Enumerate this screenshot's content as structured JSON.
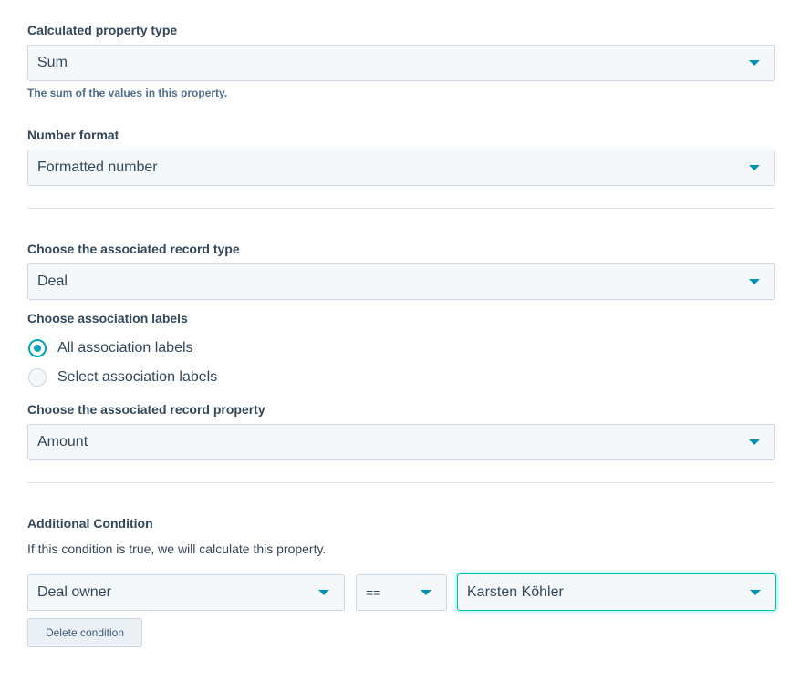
{
  "calculated_property_type": {
    "label": "Calculated property type",
    "value": "Sum",
    "help": "The sum of the values in this property."
  },
  "number_format": {
    "label": "Number format",
    "value": "Formatted number"
  },
  "associated_record_type": {
    "label": "Choose the associated record type",
    "value": "Deal"
  },
  "association_labels": {
    "label": "Choose association labels",
    "options": [
      {
        "label": "All association labels",
        "checked": true
      },
      {
        "label": "Select association labels",
        "checked": false
      }
    ]
  },
  "associated_record_property": {
    "label": "Choose the associated record property",
    "value": "Amount"
  },
  "additional_condition": {
    "label": "Additional Condition",
    "description": "If this condition is true, we will calculate this property.",
    "property_value": "Deal owner",
    "operator_value": "==",
    "value_value": "Karsten Köhler",
    "delete_label": "Delete condition"
  },
  "colors": {
    "accent": "#00a4bd",
    "caret": "#0091ae",
    "input_bg": "#f5f8fa",
    "border": "#cbd6e2",
    "focus_border": "#00bda5",
    "text": "#33475b"
  },
  "icons": {
    "dropdown": "chevron-down-icon",
    "radio_checked": "radio-checked-icon",
    "radio_unchecked": "radio-unchecked-icon"
  }
}
